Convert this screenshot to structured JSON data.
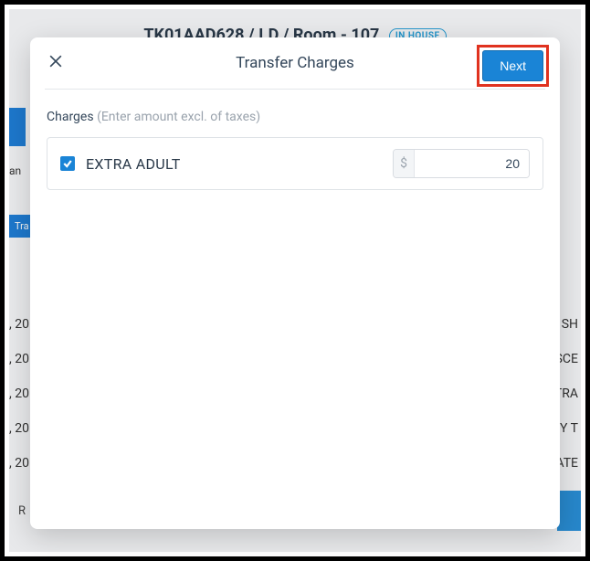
{
  "background": {
    "header_text": "TK01AAD628 / I.D / Room - 107",
    "status_badge": "IN HOUSE",
    "left_jan": "an",
    "left_tab": "Tra",
    "dates": [
      ", 20",
      ", 20",
      ", 20",
      ", 20",
      ", 20"
    ],
    "right_items": [
      "SH",
      "SCE",
      "TRA",
      "Y T",
      "ATE"
    ],
    "bottom_left": "R"
  },
  "modal": {
    "title": "Transfer Charges",
    "next_label": "Next",
    "section": {
      "label": "Charges",
      "hint": "(Enter amount excl. of taxes)"
    },
    "charges": [
      {
        "checked": true,
        "name": "EXTRA ADULT",
        "currency": "$",
        "amount": "20"
      }
    ]
  }
}
